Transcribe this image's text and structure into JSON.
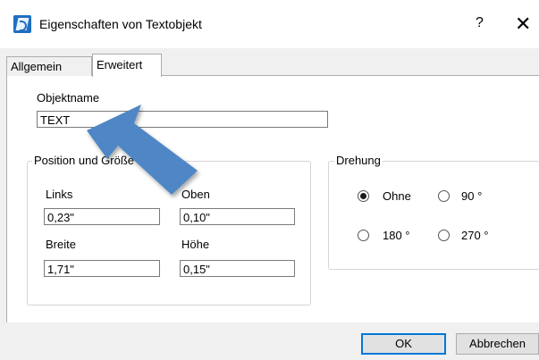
{
  "window": {
    "title": "Eigenschaften von Textobjekt",
    "help_label": "?",
    "close_label": "✕"
  },
  "tabs": [
    {
      "label": "Allgemein",
      "active": false
    },
    {
      "label": "Erweitert",
      "active": true
    }
  ],
  "object_name": {
    "label": "Objektname",
    "value": "TEXT"
  },
  "position_group": {
    "caption": "Position und Größe",
    "left_label": "Links",
    "left_value": "0,23\"",
    "top_label": "Oben",
    "top_value": "0,10\"",
    "width_label": "Breite",
    "width_value": "1,71\"",
    "height_label": "Höhe",
    "height_value": "0,15\""
  },
  "rotation_group": {
    "caption": "Drehung",
    "options": [
      {
        "label": "Ohne",
        "checked": true
      },
      {
        "label": "90 °",
        "checked": false
      },
      {
        "label": "180 °",
        "checked": false
      },
      {
        "label": "270 °",
        "checked": false
      }
    ]
  },
  "buttons": {
    "ok": "OK",
    "cancel": "Abbrechen"
  },
  "colors": {
    "accent": "#0078d7",
    "arrow": "#4f86c6"
  },
  "icons": [
    "app-icon",
    "help-icon",
    "close-icon",
    "pointer-arrow-annotation"
  ]
}
